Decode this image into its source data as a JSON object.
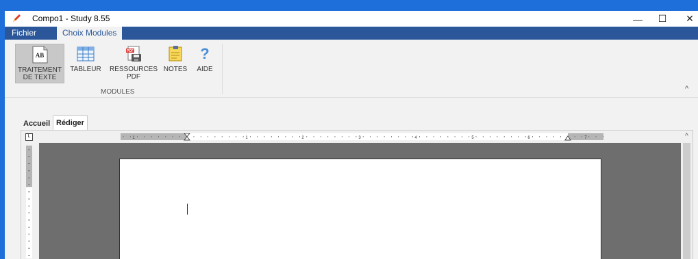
{
  "window": {
    "title": "Compo1 - Study 8.55",
    "controls": {
      "minimize": "—",
      "maximize": "☐",
      "close": "✕"
    }
  },
  "ribbon_tabs": [
    "Fichier",
    "Choix Modules"
  ],
  "ribbon": {
    "buttons": [
      {
        "line1": "TRAITEMENT",
        "line2": "DE TEXTE",
        "icon": "text-processing-icon"
      },
      {
        "line1": "TABLEUR",
        "line2": "",
        "icon": "spreadsheet-icon"
      },
      {
        "line1": "RESSOURCES",
        "line2": "PDF",
        "icon": "pdf-resources-icon"
      },
      {
        "line1": "NOTES",
        "line2": "",
        "icon": "notes-icon"
      },
      {
        "line1": "AIDE",
        "line2": "",
        "icon": "help-icon"
      }
    ],
    "icon_text": {
      "ab": "AB",
      "pdf": "PDF",
      "help": "?"
    },
    "group_label": "MODULES",
    "collapse_glyph": "^"
  },
  "doc_tabs": [
    "Accueil",
    "Rédiger"
  ],
  "editor": {
    "ruler_numbers": [
      "1",
      "1",
      "2",
      "3",
      "4",
      "5",
      "6",
      "7"
    ],
    "tab_selector_glyph": "L",
    "scroll_up_glyph": "^"
  },
  "colors": {
    "titlebar_accent": "#1e6fd9",
    "ribbon_tab_bar": "#2b579a",
    "workspace": "#6e6e6e"
  }
}
